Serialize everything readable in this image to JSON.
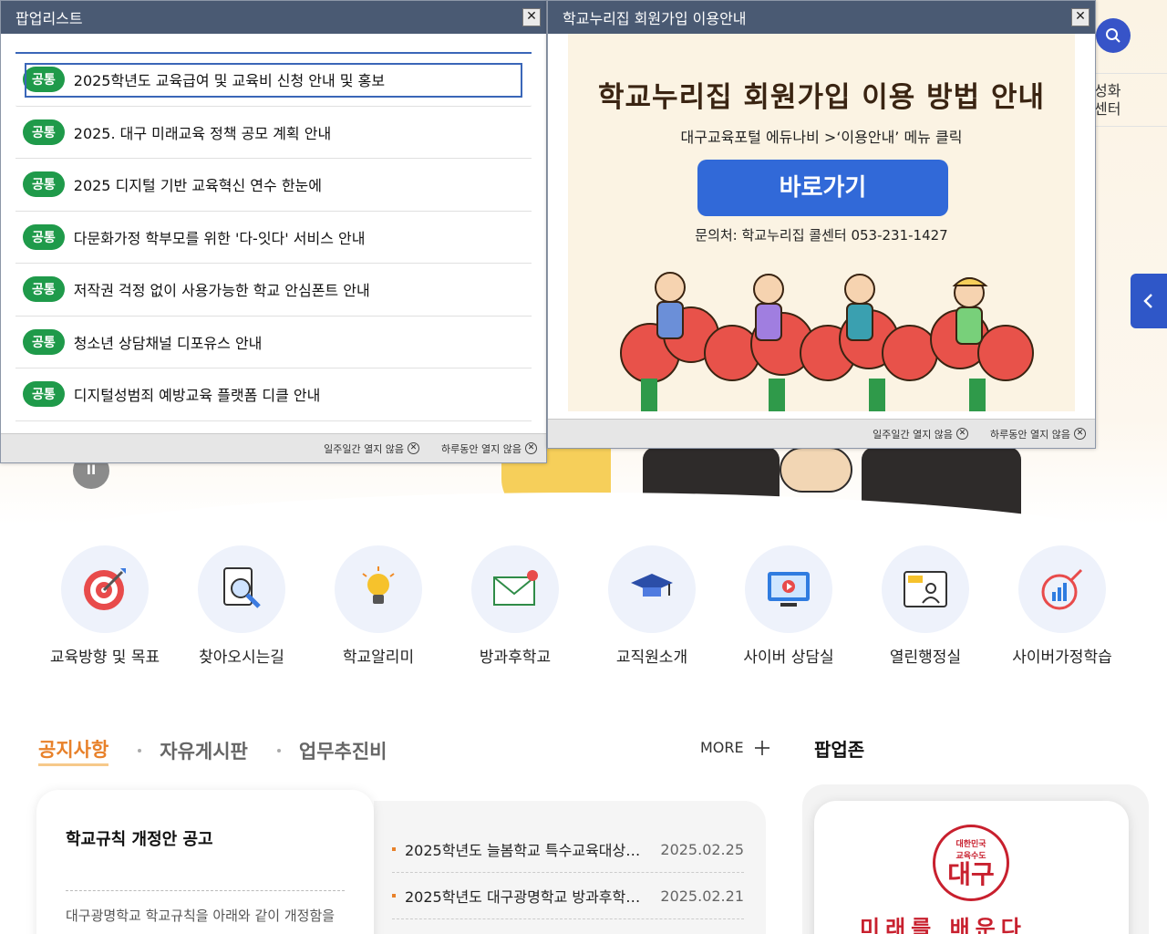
{
  "colors": {
    "header": "#4a5a73",
    "badge": "#1f9a4a",
    "accent": "#e8812a",
    "primary": "#3169d8"
  },
  "header_menu": {
    "text": "성화\n센터"
  },
  "quick_links": [
    {
      "label": "교육방향 및 목표",
      "icon": "target-icon"
    },
    {
      "label": "찾아오시는길",
      "icon": "map-search-icon"
    },
    {
      "label": "학교알리미",
      "icon": "lightbulb-icon"
    },
    {
      "label": "방과후학교",
      "icon": "mail-icon"
    },
    {
      "label": "교직원소개",
      "icon": "graduation-cap-icon"
    },
    {
      "label": "사이버 상담실",
      "icon": "monitor-play-icon"
    },
    {
      "label": "열린행정실",
      "icon": "profile-board-icon"
    },
    {
      "label": "사이버가정학습",
      "icon": "chart-growth-icon"
    }
  ],
  "board": {
    "tabs": [
      "공지사항",
      "자유게시판",
      "업무추진비"
    ],
    "more": "MORE",
    "featured": {
      "title": "학교규칙 개정안 공고",
      "body": "대구광명학교 학교규칙을 아래와 같이 개정함을"
    },
    "items": [
      {
        "title": "2025학년도 늘봄학교 특수교육대상자 ...",
        "date": "2025.02.25"
      },
      {
        "title": "2025학년도 대구광명학교 방과후학교 ...",
        "date": "2025.02.21"
      }
    ]
  },
  "popupzone": {
    "title": "팝업존",
    "logo_small": "대한민국",
    "logo_mid": "교육수도",
    "logo_big": "대구",
    "slogan": "미래를 배운다"
  },
  "popup_list": {
    "title": "팝업리스트",
    "items": [
      {
        "badge": "공통",
        "title": "2025학년도 교육급여 및 교육비 신청 안내 및 홍보"
      },
      {
        "badge": "공통",
        "title": "2025. 대구 미래교육 정책 공모 계획 안내"
      },
      {
        "badge": "공통",
        "title": "2025 디지털 기반 교육혁신 연수 한눈에"
      },
      {
        "badge": "공통",
        "title": "다문화가정 학부모를 위한 '다-잇다' 서비스 안내"
      },
      {
        "badge": "공통",
        "title": "저작권 걱정 없이 사용가능한 학교 안심폰트 안내"
      },
      {
        "badge": "공통",
        "title": "청소년 상담채널 디포유스 안내"
      },
      {
        "badge": "공통",
        "title": "디지털성범죄 예방교육 플랫폼 디클 안내"
      }
    ],
    "week_close": "일주일간 열지 않음",
    "day_close": "하루동안 열지 않음"
  },
  "popup_signup": {
    "title": "학교누리집 회원가입 이용안내",
    "heading": "학교누리집 회원가입 이용 방법 안내",
    "sub": "대구교육포털 에듀나비  >‘이용안내’ 메뉴 클릭",
    "button": "바로가기",
    "contact": "문의처: 학교누리집 콜센터 053-231-1427",
    "week_close": "일주일간 열지 않음",
    "day_close": "하루동안 열지 않음"
  }
}
